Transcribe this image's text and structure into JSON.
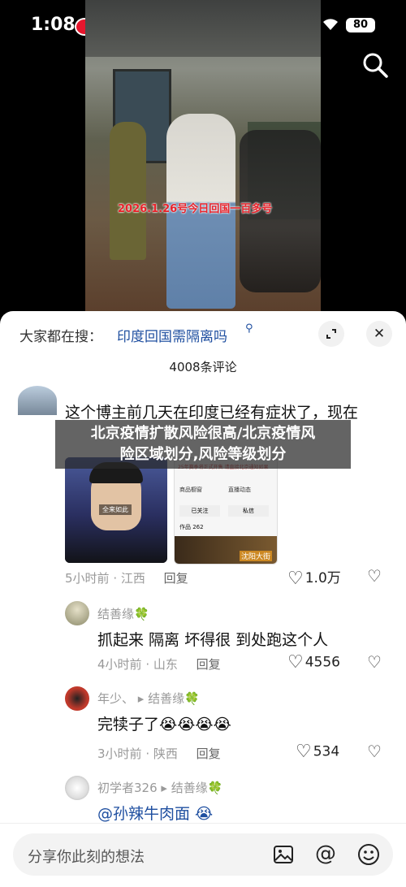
{
  "status": {
    "time": "1:08",
    "dots": "···",
    "battery": "80"
  },
  "video": {
    "caption": "2026.1.26号今日回国一百多号"
  },
  "sheet": {
    "search_label": "大家都在搜：",
    "search_query": "印度回国需隔离吗",
    "comment_count": "4008条评论"
  },
  "banner": {
    "line1": "北京疫情扩散风险很高/北京疫情风",
    "line2": "险区域划分,风险等级划分"
  },
  "comments": [
    {
      "text": "这个博主前几天在印度已经有症状了，现在",
      "time": "5小时前",
      "location": "江西",
      "reply": "回复",
      "likes": "1.0万"
    },
    {
      "user": "结善缘🍀",
      "text": "抓起来 隔离 坏得很 到处跑这个人",
      "time": "4小时前",
      "location": "山东",
      "reply": "回复",
      "likes": "4556"
    },
    {
      "user": "年少、",
      "reply_to": "结善缘🍀",
      "text": "完犊子了😭😭😭😭",
      "time": "3小时前",
      "location": "陕西",
      "reply": "回复",
      "likes": "534"
    },
    {
      "user": "初学者326",
      "reply_to": "结善缘🍀",
      "text": "@孙辣牛肉面 😭"
    }
  ],
  "thumb_b": {
    "header": "25年赛季将正式开售 请直接北京通知如果",
    "tab1": "商品橱窗",
    "tab2": "直播动态",
    "follow": "已关注",
    "msg": "私信",
    "label": "作品 262"
  },
  "thumb_a": {
    "badge": "全来如此"
  },
  "thumb_sign": "沈阳大街",
  "input": {
    "placeholder": "分享你此刻的想法"
  },
  "colors": {
    "link": "#1f4fa0",
    "banner_bg": "rgba(40,40,40,.72)",
    "caption": "#e8232b"
  }
}
